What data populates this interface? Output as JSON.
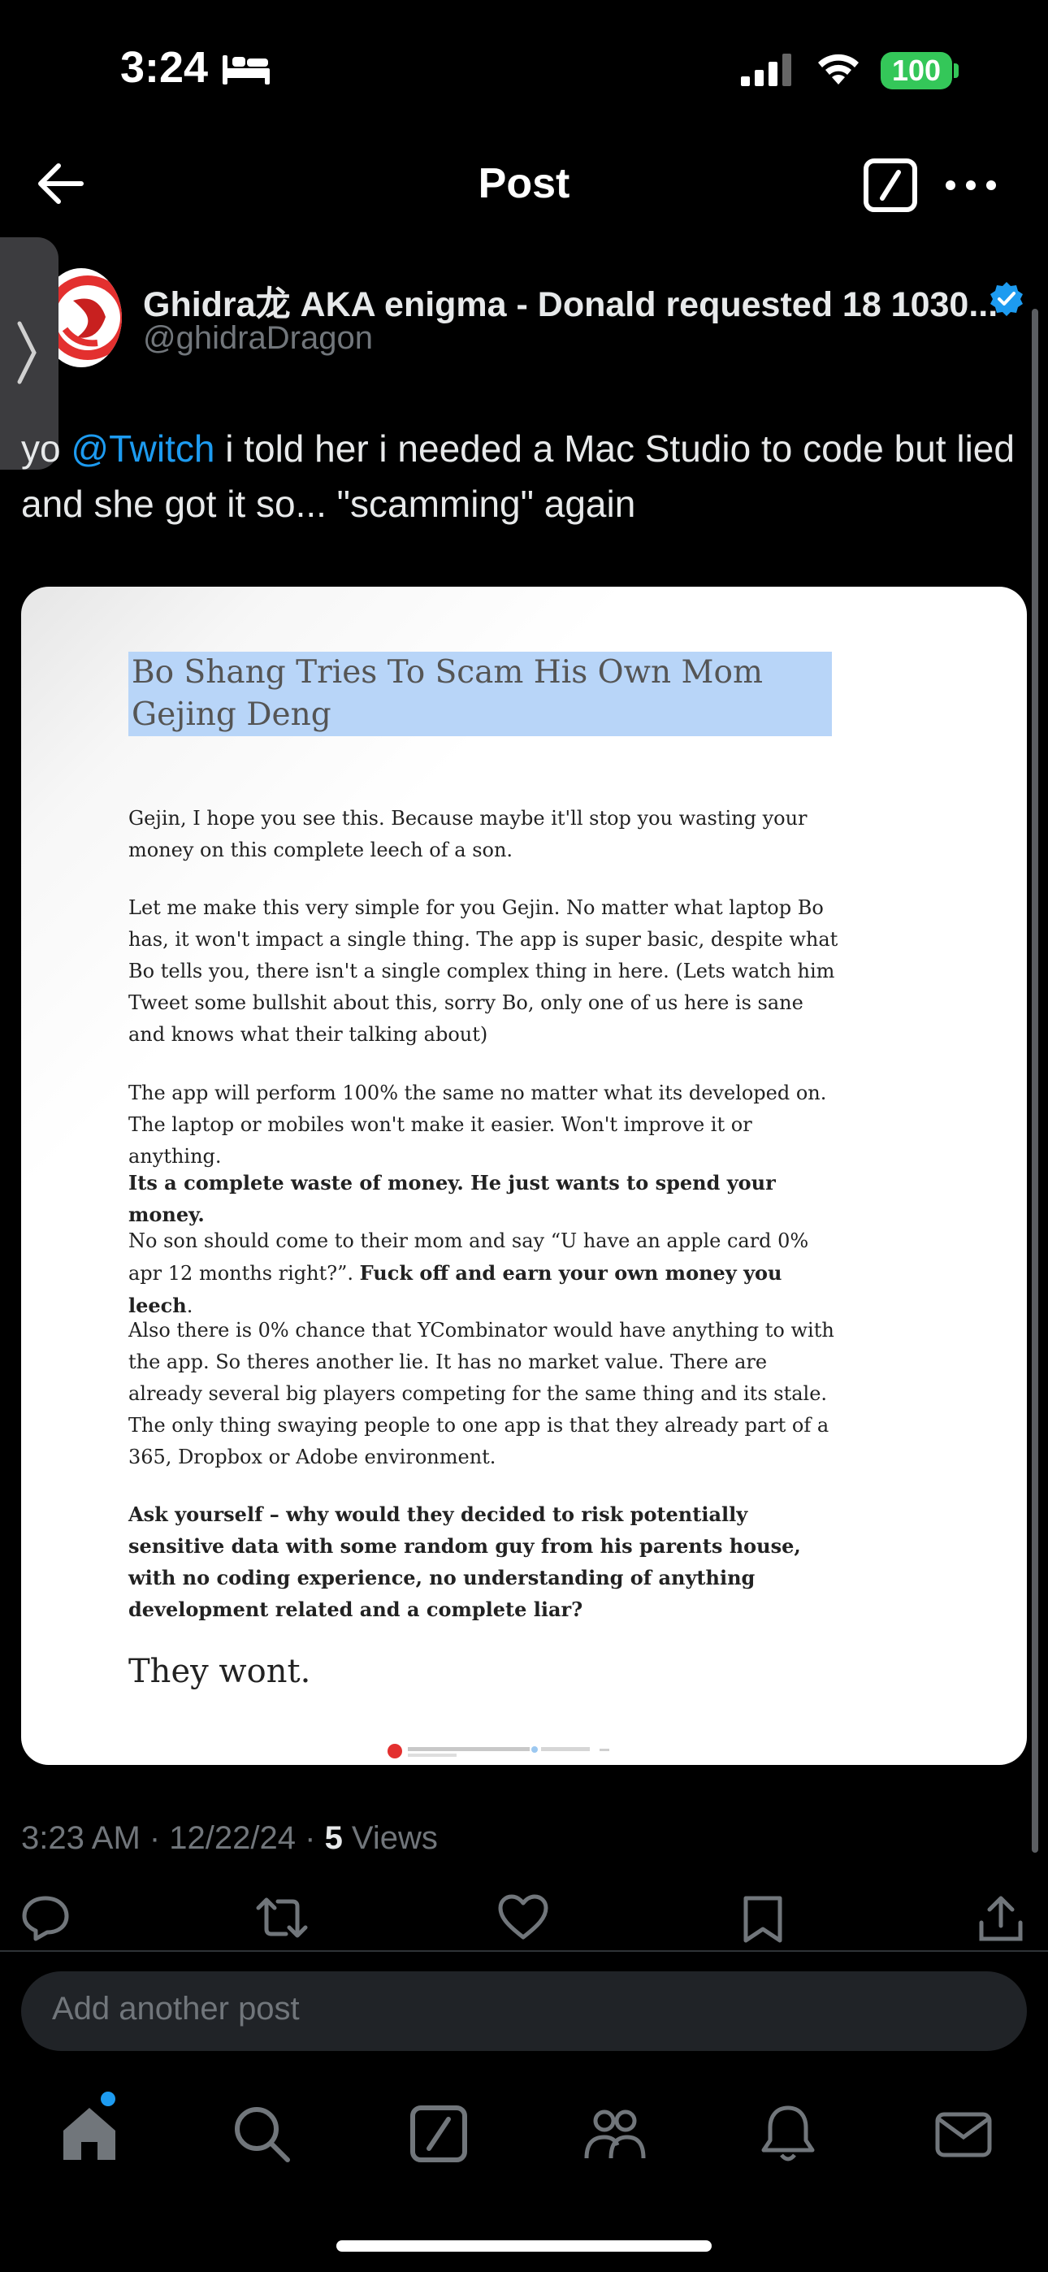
{
  "status_bar": {
    "time": "3:24",
    "battery": "100",
    "focus_icon": "bed-icon"
  },
  "header": {
    "title": "Post",
    "back_icon": "arrow-left-icon",
    "grok_icon": "grok-icon",
    "more_icon": "more-icon"
  },
  "author": {
    "name": "Ghidra龙 AKA enigma - Donald requested 18 1030...",
    "handle": "@ghidraDragon",
    "verified": true
  },
  "post": {
    "text_prefix": "yo ",
    "mention": "@Twitch",
    "text_rest": " i told her i needed a Mac Studio to code but lied and she got it so... \"scamming\" again",
    "timestamp": "3:23 AM · 12/22/24 · ",
    "views_count": "5",
    "views_label": " Views"
  },
  "document": {
    "title": "Bo Shang Tries To Scam His Own Mom Gejing Deng",
    "p1": "Gejin, I hope you see this. Because maybe it'll stop you wasting your money on this complete leech of a son.",
    "p2": "Let me make this very simple for you Gejin. No matter what laptop Bo has, it won't impact a single thing. The app is super basic, despite what Bo tells you, there isn't a single complex thing in here. (Lets watch him Tweet some bullshit about this, sorry Bo, only one of us here is sane and knows what their talking about)",
    "p3": "The app will perform 100% the same no matter what its developed on. The laptop or mobiles won't make it easier. Won't improve it or anything.",
    "p4": "Its a complete waste of money. He just wants to spend your money.",
    "p5_normal": "No son should come to their mom and say “U have an apple card 0% apr 12 months right?”. ",
    "p5_bold": "Fuck off and earn your own money you leech",
    "p5_end": ".",
    "p6": "Also there is 0% chance that YCombinator would have anything to with the app. So theres another lie. It has no market value. There are already several big players competing for the same thing and its stale. The only thing swaying people to one app is that they already part of a 365, Dropbox or Adobe environment.",
    "p7": "Ask yourself – why would they decided to risk potentially sensitive data with some random guy from his parents house, with no coding experience, no understanding of anything development related and a complete liar?",
    "closing": "They wont."
  },
  "actions": [
    "reply-icon",
    "repost-icon",
    "like-icon",
    "bookmark-icon",
    "share-icon"
  ],
  "reply_box": {
    "placeholder": "Add another post"
  },
  "bottom_nav": [
    "home-icon",
    "search-icon",
    "grok-icon",
    "communities-icon",
    "notifications-icon",
    "messages-icon"
  ],
  "colors": {
    "accent": "#1d9bf0",
    "background": "#000000",
    "muted": "#71767b",
    "battery": "#34c759"
  }
}
